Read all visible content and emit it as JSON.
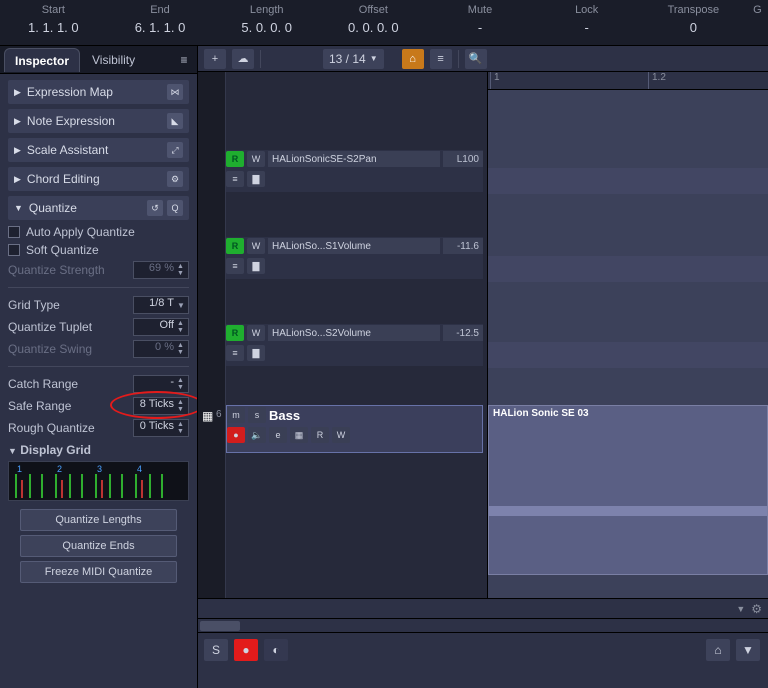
{
  "info": {
    "start": {
      "label": "Start",
      "value": "1. 1. 1. 0"
    },
    "end": {
      "label": "End",
      "value": "6. 1. 1. 0"
    },
    "length": {
      "label": "Length",
      "value": "5. 0. 0. 0"
    },
    "offset": {
      "label": "Offset",
      "value": "0. 0. 0. 0"
    },
    "mute": {
      "label": "Mute",
      "value": "-"
    },
    "lock": {
      "label": "Lock",
      "value": "-"
    },
    "transpose": {
      "label": "Transpose",
      "value": "0"
    },
    "g": {
      "label": "G",
      "value": ""
    }
  },
  "tabs": {
    "inspector": "Inspector",
    "visibility": "Visibility"
  },
  "inspector": {
    "sections": {
      "expressionMap": "Expression Map",
      "noteExpression": "Note Expression",
      "scaleAssistant": "Scale Assistant",
      "chordEditing": "Chord Editing",
      "quantize": "Quantize",
      "displayGrid": "Display Grid"
    },
    "autoApply": "Auto Apply Quantize",
    "softQuantize": "Soft Quantize",
    "quantizeStrength": {
      "label": "Quantize Strength",
      "value": "69 %"
    },
    "gridType": {
      "label": "Grid Type",
      "value": "1/8 T"
    },
    "quantizeTuplet": {
      "label": "Quantize Tuplet",
      "value": "Off"
    },
    "quantizeSwing": {
      "label": "Quantize Swing",
      "value": "0 %"
    },
    "catchRange": {
      "label": "Catch Range",
      "value": "-"
    },
    "safeRange": {
      "label": "Safe Range",
      "value": "8 Ticks"
    },
    "roughQuantize": {
      "label": "Rough Quantize",
      "value": "0 Ticks"
    },
    "buttons": {
      "quantizeLengths": "Quantize Lengths",
      "quantizeEnds": "Quantize Ends",
      "freezeMidi": "Freeze MIDI Quantize"
    }
  },
  "toolbar": {
    "counter": "13 / 14"
  },
  "timeline": {
    "marker1": "1",
    "marker12": "1.2"
  },
  "tracks": {
    "t1": {
      "name": "HALionSonicSE-S2Pan",
      "value": "L100"
    },
    "t2": {
      "name": "HALionSo...S1Volume",
      "value": "-11.6"
    },
    "t3": {
      "name": "HALionSo...S2Volume",
      "value": "-12.5"
    },
    "bass": {
      "index": "6",
      "name": "Bass"
    }
  },
  "clip": {
    "title": "HALion Sonic SE 03"
  },
  "trackLabels": {
    "R": "R",
    "W": "W",
    "M": "m",
    "S": "s",
    "e": "e"
  }
}
